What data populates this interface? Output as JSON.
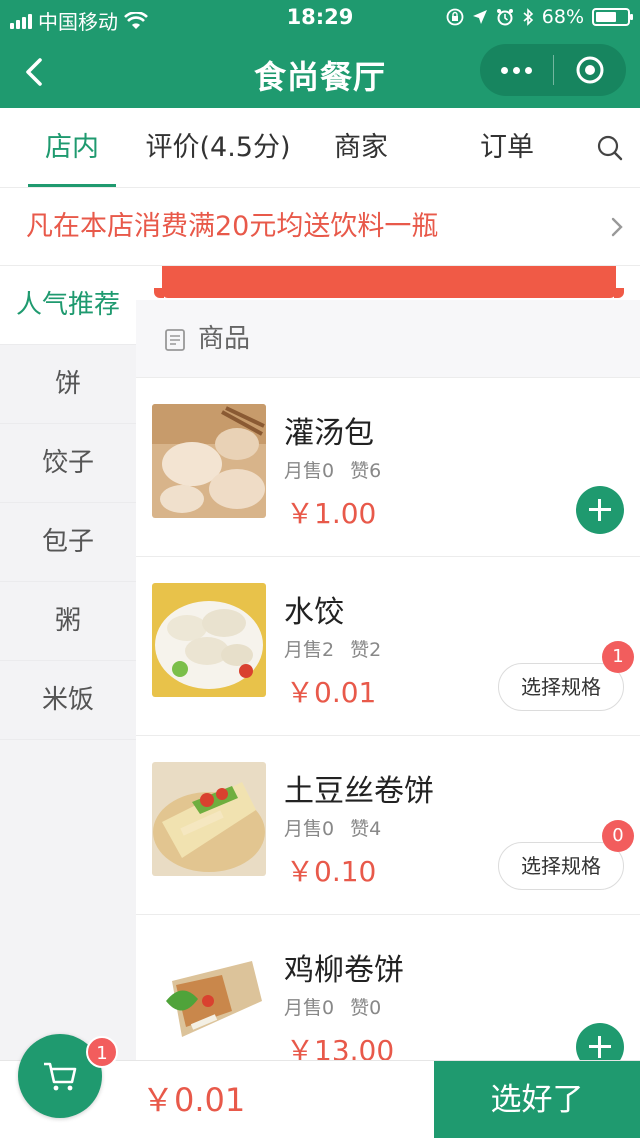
{
  "status_bar": {
    "carrier": "中国移动",
    "time": "18:29",
    "battery": "68%",
    "battery_level": 0.68
  },
  "nav": {
    "title": "食尚餐厅"
  },
  "tabs": [
    {
      "label": "店内",
      "active": true
    },
    {
      "label": "评价(4.5分)",
      "active": false
    },
    {
      "label": "商家",
      "active": false
    },
    {
      "label": "订单",
      "active": false
    }
  ],
  "promo": {
    "text": "凡在本店消费满20元均送饮料一瓶"
  },
  "sidebar": {
    "items": [
      {
        "label": "人气推荐",
        "active": true
      },
      {
        "label": "饼",
        "active": false
      },
      {
        "label": "饺子",
        "active": false
      },
      {
        "label": "包子",
        "active": false
      },
      {
        "label": "粥",
        "active": false
      },
      {
        "label": "米饭",
        "active": false
      }
    ]
  },
  "section": {
    "label": "商品"
  },
  "products": [
    {
      "name": "灌汤包",
      "sales": "月售0",
      "likes": "赞6",
      "price": "￥1.00",
      "action": "add"
    },
    {
      "name": "水饺",
      "sales": "月售2",
      "likes": "赞2",
      "price": "￥0.01",
      "action": "spec",
      "spec_label": "选择规格",
      "badge": "1"
    },
    {
      "name": "土豆丝卷饼",
      "sales": "月售0",
      "likes": "赞4",
      "price": "￥0.10",
      "action": "spec",
      "spec_label": "选择规格",
      "badge": "0"
    },
    {
      "name": "鸡柳卷饼",
      "sales": "月售0",
      "likes": "赞0",
      "price": "￥13.00",
      "action": "add"
    }
  ],
  "cart": {
    "badge": "1",
    "total": "￥0.01",
    "checkout_label": "选好了"
  },
  "colors": {
    "brand": "#1f9a6f",
    "price": "#e8594a",
    "badge": "#f25d5d"
  },
  "icons": [
    "back-arrow-icon",
    "more-dots-icon",
    "target-icon",
    "search-icon",
    "chevron-right-icon",
    "document-icon",
    "cart-icon",
    "plus-icon",
    "wifi-icon"
  ]
}
